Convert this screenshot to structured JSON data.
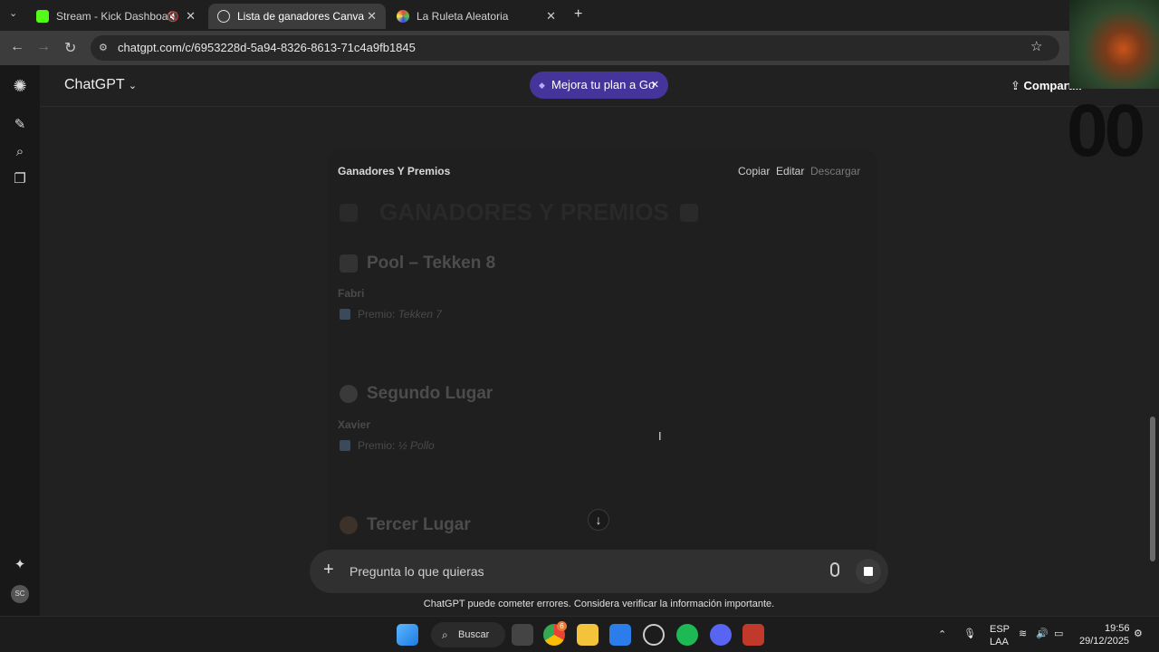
{
  "tabs": [
    {
      "label": "Stream - Kick Dashboard"
    },
    {
      "label": "Lista de ganadores Canva"
    },
    {
      "label": "La Ruleta Aleatoria"
    }
  ],
  "address": {
    "url": "chatgpt.com/c/6953228d-5a94-8326-8613-71c4a9fb1845"
  },
  "header": {
    "model": "ChatGPT",
    "upgrade": "Mejora tu plan a Go",
    "share": "Compart..."
  },
  "document": {
    "title": "Ganadores Y Premios",
    "actions": {
      "copy": "Copiar",
      "edit": "Editar",
      "download": "Descargar"
    },
    "heading": "GANADORES Y PREMIOS",
    "sections": [
      {
        "heading": "Pool – Tekken 8",
        "name": "Fabri",
        "prize_label": "Premio:",
        "prize_value": "Tekken 7"
      },
      {
        "heading": "Segundo Lugar",
        "name": "Xavier",
        "prize_label": "Premio:",
        "prize_value": "½ Pollo"
      },
      {
        "heading": "Tercer Lugar"
      }
    ]
  },
  "composer": {
    "placeholder": "Pregunta lo que quieras"
  },
  "disclaimer": "ChatGPT puede cometer errores. Considera verificar la información importante.",
  "sidebar": {
    "avatar": "SC"
  },
  "overlay": {
    "counter": "00"
  },
  "taskbar": {
    "search": "Buscar",
    "badge_chrome": "6"
  },
  "tray": {
    "lang": "ESP",
    "layout": "LAA",
    "time": "19:56",
    "date": "29/12/2025"
  },
  "colors": {
    "accent": "#45349a",
    "bg": "#212121"
  }
}
